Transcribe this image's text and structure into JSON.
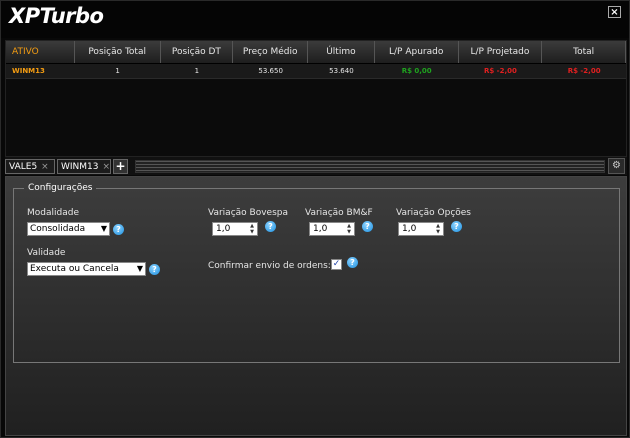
{
  "window": {
    "title": "XPTurbo",
    "close_symbol": "×"
  },
  "grid": {
    "columns": [
      "ATIVO",
      "Posição Total",
      "Posição DT",
      "Preço Médio",
      "Último",
      "L/P Apurado",
      "L/P Projetado",
      "Total"
    ],
    "rows": [
      {
        "ativo": "WINM13",
        "posicao_total": "1",
        "posicao_dt": "1",
        "preco_medio": "53.650",
        "ultimo": "53.640",
        "lp_apurado": "R$ 0,00",
        "lp_projetado": "R$ -2,00",
        "total": "R$ -2,00"
      }
    ]
  },
  "tabs": [
    {
      "label": "VALE5",
      "close": "×"
    },
    {
      "label": "WINM13",
      "close": "×"
    }
  ],
  "add_tab_label": "+",
  "settings_icon": "gear-icon",
  "config": {
    "legend": "Configurações",
    "modalidade": {
      "label": "Modalidade",
      "value": "Consolidada"
    },
    "validade": {
      "label": "Validade",
      "value": "Executa ou Cancela"
    },
    "variacao_bovespa": {
      "label": "Variação Bovespa",
      "value": "1,0"
    },
    "variacao_bmf": {
      "label": "Variação BM&F",
      "value": "1,0"
    },
    "variacao_opcoes": {
      "label": "Variação Opções",
      "value": "1,0"
    },
    "confirmar": {
      "label": "Confirmar envio de ordens:",
      "checked": true
    },
    "help_symbol": "?"
  },
  "colors": {
    "accent_orange": "#f39c12",
    "positive": "#1fa21f",
    "negative": "#e02020",
    "help_blue": "#1a8fe0"
  }
}
